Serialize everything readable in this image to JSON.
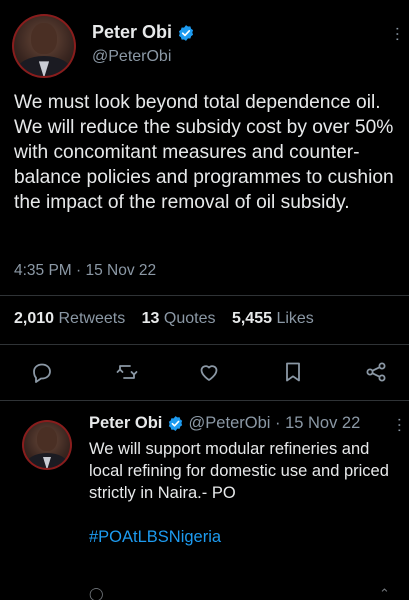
{
  "main_tweet": {
    "author_name": "Peter Obi",
    "handle": "@PeterObi",
    "text": "We must look beyond total dependence oil. We will reduce the subsidy cost by over 50% with concomitant measures and counter-balance policies and programmes to cushion the impact of the removal of oil subsidy.",
    "timestamp": "4:35 PM · 15 Nov 22",
    "stats": {
      "retweets_count": "2,010",
      "retweets_label": "Retweets",
      "quotes_count": "13",
      "quotes_label": "Quotes",
      "likes_count": "5,455",
      "likes_label": "Likes"
    },
    "actions": [
      "reply-icon",
      "retweet-icon",
      "like-icon",
      "bookmark-icon",
      "share-icon"
    ]
  },
  "reply_tweet": {
    "author_name": "Peter Obi",
    "handle_date": "@PeterObi · 15 Nov 22",
    "text": "We will support modular refineries and local refining for domestic use and priced strictly in Naira.- PO",
    "hashtag": "#POAtLBSNigeria"
  },
  "colors": {
    "background": "#000000",
    "text_primary": "#e7e9ea",
    "text_secondary": "#8b98a5",
    "accent": "#1d9bf0",
    "divider": "#2f3336"
  }
}
